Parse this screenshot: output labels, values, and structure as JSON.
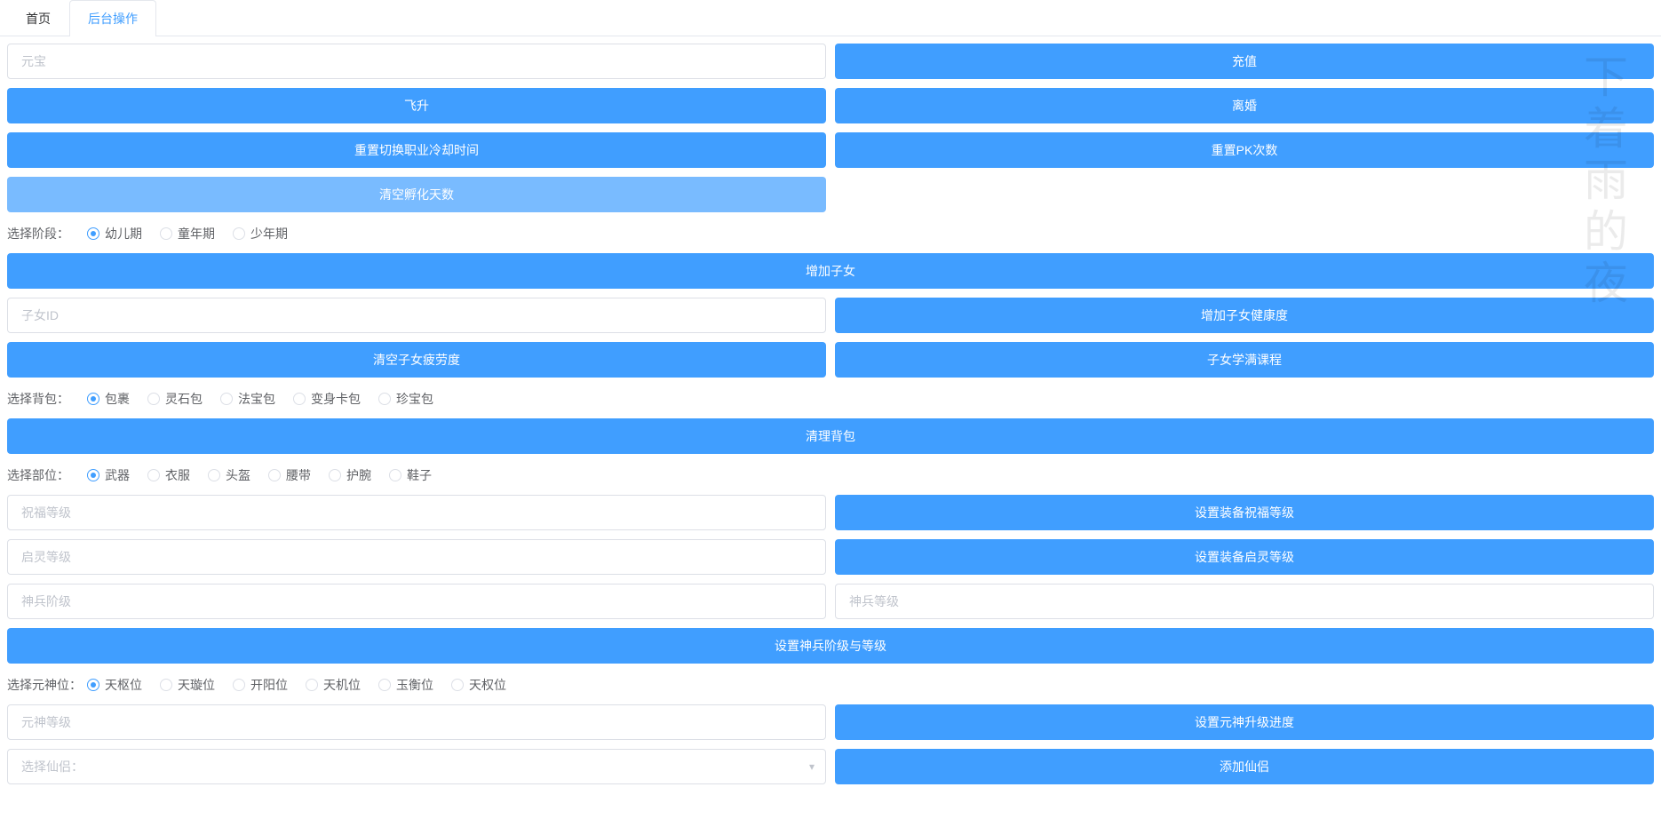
{
  "tabs": {
    "home": "首页",
    "backend": "后台操作"
  },
  "inputs": {
    "yuanbao": "元宝",
    "child_id": "子女ID",
    "bless_level": "祝福等级",
    "enlighten_level": "启灵等级",
    "weapon_stage": "神兵阶级",
    "weapon_level": "神兵等级",
    "spirit_level": "元神等级",
    "select_partner": "选择仙侣："
  },
  "buttons": {
    "recharge": "充值",
    "ascend": "飞升",
    "divorce": "离婚",
    "reset_job_cd": "重置切换职业冷却时间",
    "reset_pk": "重置PK次数",
    "clear_hatch": "清空孵化天数",
    "add_child": "增加子女",
    "add_child_health": "增加子女健康度",
    "clear_child_fatigue": "清空子女疲劳度",
    "child_full_course": "子女学满课程",
    "clear_bag": "清理背包",
    "set_bless": "设置装备祝福等级",
    "set_enlighten": "设置装备启灵等级",
    "set_weapon": "设置神兵阶级与等级",
    "set_spirit": "设置元神升级进度",
    "add_partner": "添加仙侣"
  },
  "radios": {
    "stage_label": "选择阶段：",
    "stage_options": [
      "幼儿期",
      "童年期",
      "少年期"
    ],
    "bag_label": "选择背包：",
    "bag_options": [
      "包裹",
      "灵石包",
      "法宝包",
      "变身卡包",
      "珍宝包"
    ],
    "part_label": "选择部位：",
    "part_options": [
      "武器",
      "衣服",
      "头盔",
      "腰带",
      "护腕",
      "鞋子"
    ],
    "spirit_label": "选择元神位：",
    "spirit_options": [
      "天枢位",
      "天璇位",
      "开阳位",
      "天机位",
      "玉衡位",
      "天权位"
    ]
  },
  "watermark": "下着雨的夜"
}
